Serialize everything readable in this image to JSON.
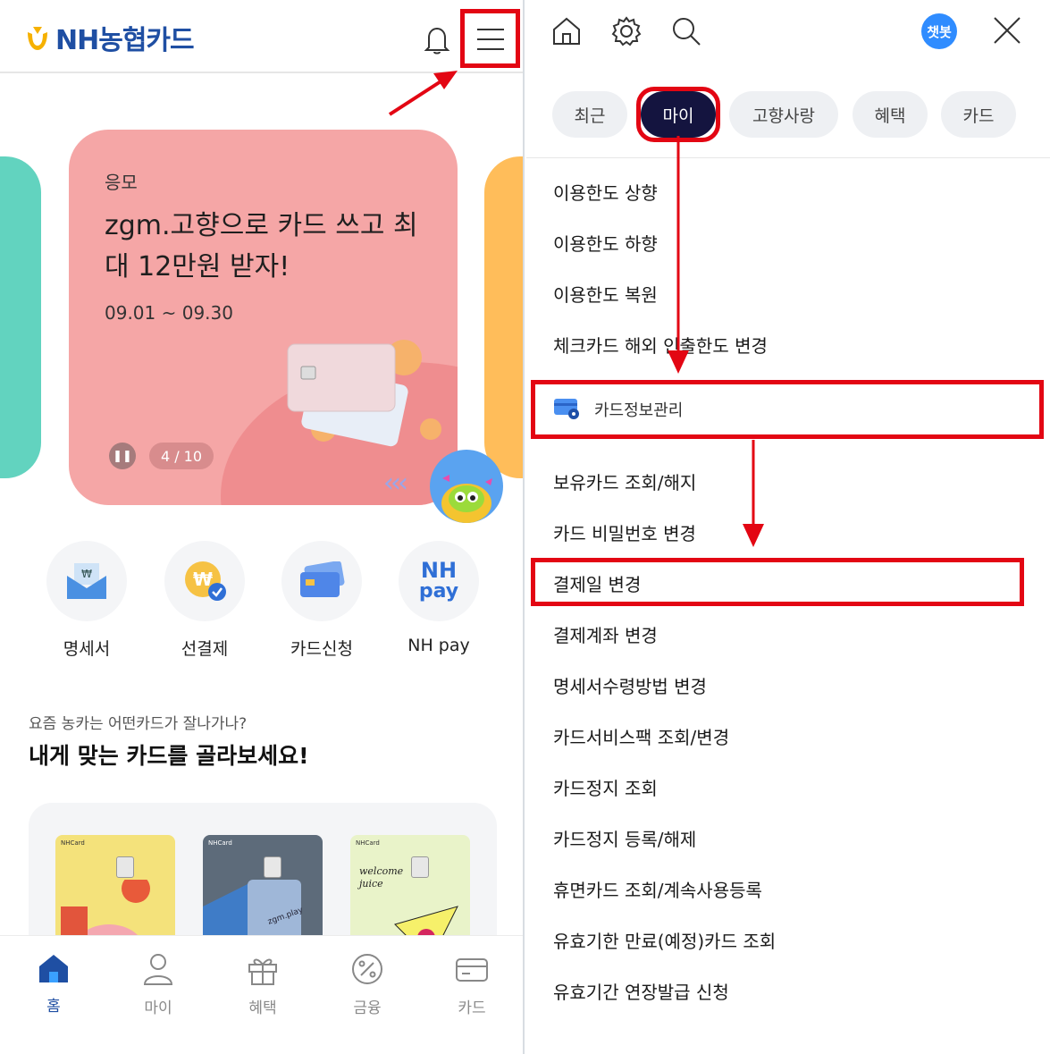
{
  "left": {
    "header": {
      "logo_text": "NH농협카드",
      "logo_icon": "nh-emblem-icon",
      "bell_icon": "bell-icon",
      "menu_icon": "hamburger-menu-icon"
    },
    "promo": {
      "tag": "응모",
      "title": "zgm.고향으로 카드 쓰고 최대 12만원 받자!",
      "period": "09.01 ~ 09.30",
      "pause_symbol": "❚❚",
      "counter": "4 / 10",
      "chevrons": "‹‹‹"
    },
    "quick_menu": [
      {
        "label": "명세서",
        "icon": "statement-envelope-icon"
      },
      {
        "label": "선결제",
        "icon": "prepay-coin-icon"
      },
      {
        "label": "카드신청",
        "icon": "card-apply-icon"
      },
      {
        "label": "NH pay",
        "icon": "nh-pay-icon"
      }
    ],
    "nh_pay_logo": {
      "line1": "NH",
      "line2": "pay"
    },
    "recommend": {
      "subtitle": "요즘 농카는 어떤카드가 잘나가나?",
      "title": "내게 맞는 카드를 골라보세요!"
    },
    "card_brand": "NHCard",
    "mini_cards": [
      {
        "caption": "",
        "color": "#f4e27b"
      },
      {
        "caption": "zgm.play",
        "color": "#5d6b7a"
      },
      {
        "caption": "welcome juice",
        "color": "#e9f3c9"
      }
    ],
    "bottom_nav": [
      {
        "label": "홈",
        "icon": "home-icon",
        "active": true
      },
      {
        "label": "마이",
        "icon": "person-icon",
        "active": false
      },
      {
        "label": "혜택",
        "icon": "gift-icon",
        "active": false
      },
      {
        "label": "금융",
        "icon": "percent-icon",
        "active": false
      },
      {
        "label": "카드",
        "icon": "card-icon",
        "active": false
      }
    ]
  },
  "right": {
    "top_icons": [
      "home-icon",
      "settings-gear-icon",
      "search-icon"
    ],
    "chatbot_label": "챗봇",
    "close_icon": "close-x-icon",
    "tabs": [
      {
        "label": "최근",
        "selected": false
      },
      {
        "label": "마이",
        "selected": true
      },
      {
        "label": "고향사랑",
        "selected": false
      },
      {
        "label": "혜택",
        "selected": false
      },
      {
        "label": "카드",
        "selected": false
      }
    ],
    "limit_items": [
      "이용한도 상향",
      "이용한도 하향",
      "이용한도 복원",
      "체크카드 해외 인출한도 변경"
    ],
    "section_title": "카드정보관리",
    "section_icon": "card-settings-icon",
    "info_items": [
      "보유카드 조회/해지",
      "카드 비밀번호 변경",
      "결제일 변경",
      "결제계좌 변경",
      "명세서수령방법 변경",
      "카드서비스팩 조회/변경",
      "카드정지 조회",
      "카드정지 등록/해제",
      "휴면카드 조회/계속사용등록",
      "유효기한 만료(예정)카드 조회",
      "유효기간 연장발급 신청"
    ]
  },
  "colors": {
    "annotation_red": "#e30613",
    "brand_blue": "#1f4fa3",
    "selected_tab": "#14143f",
    "promo_pink": "#f5a6a6"
  }
}
